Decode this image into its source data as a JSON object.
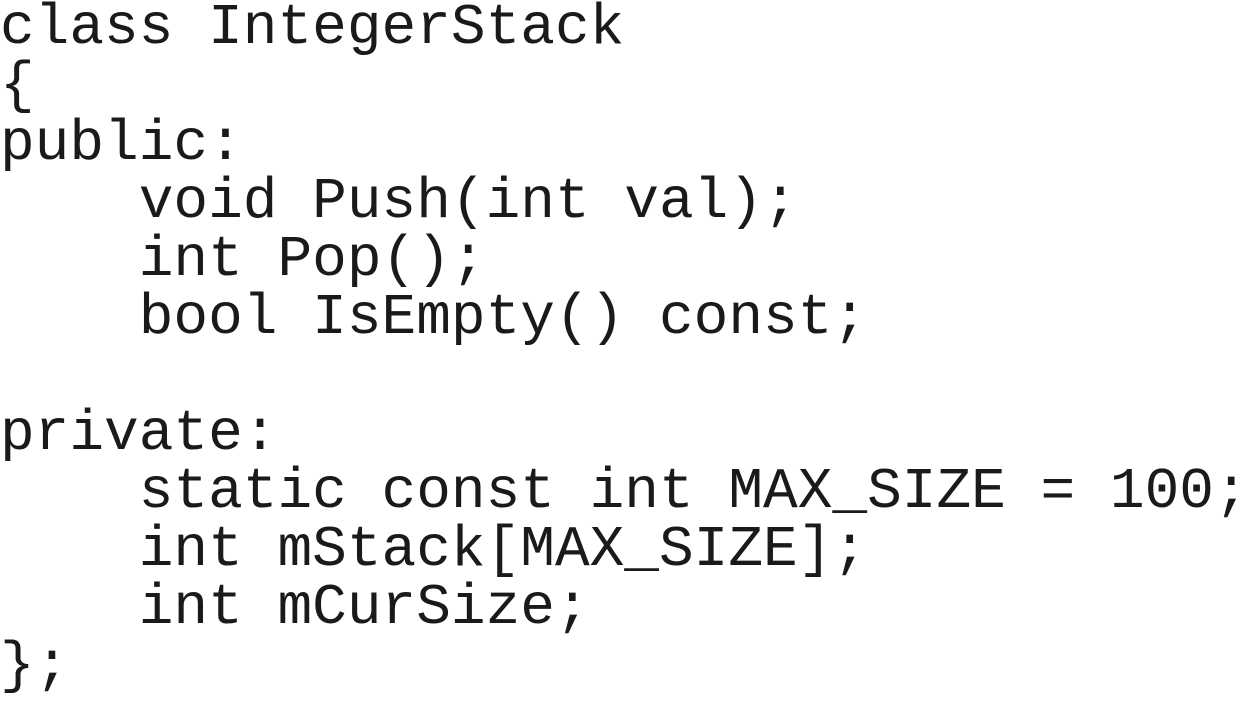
{
  "code": {
    "lines": [
      "class IntegerStack",
      "{",
      "public:",
      "    void Push(int val);",
      "    int Pop();",
      "    bool IsEmpty() const;",
      "",
      "private:",
      "    static const int MAX_SIZE = 100;",
      "    int mStack[MAX_SIZE];",
      "    int mCurSize;",
      "};"
    ]
  }
}
